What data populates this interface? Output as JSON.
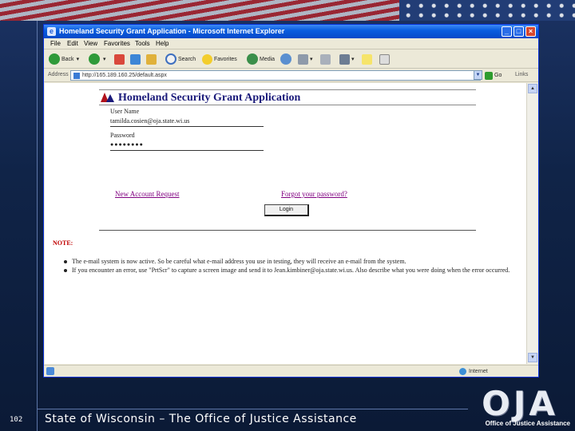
{
  "slide": {
    "number": "102",
    "footer": "State of Wisconsin – The Office of Justice Assistance",
    "logo_letters": "OJA",
    "logo_sub": "Office of Justice Assistance"
  },
  "window": {
    "title": "Homeland Security Grant Application - Microsoft Internet Explorer",
    "menu": [
      "File",
      "Edit",
      "View",
      "Favorites",
      "Tools",
      "Help"
    ],
    "toolbar": {
      "back": "Back",
      "search": "Search",
      "favorites": "Favorites",
      "media": "Media"
    },
    "address_label": "Address",
    "address_value": "http://165.189.160.25/default.aspx",
    "go_label": "Go",
    "links_label": "Links"
  },
  "page": {
    "title": "Homeland Security Grant Application",
    "user_name_label": "User Name",
    "user_name_value": "tamilda.cosien@oja.state.wi.us",
    "password_label": "Password",
    "password_value": "●●●●●●●●",
    "new_account_link": "New Account Request",
    "forgot_password_link": "Forgot your password?",
    "login_button": "Login",
    "note_heading": "NOTE:",
    "notes": [
      "The e-mail system is now active. So be careful what e-mail address you use in testing, they will receive an e-mail from the system.",
      "If you encounter an error, use \"PrtScr\" to capture a screen image and send it to Jean.kimbiner@oja.state.wi.us. Also describe what you were doing when the error occurred."
    ]
  },
  "status": {
    "zone": "Internet"
  },
  "colors": {
    "title_bar": "#0a5ee0",
    "page_title": "#1a1a7a",
    "visited_link": "#800080",
    "note_heading": "#c00000"
  }
}
